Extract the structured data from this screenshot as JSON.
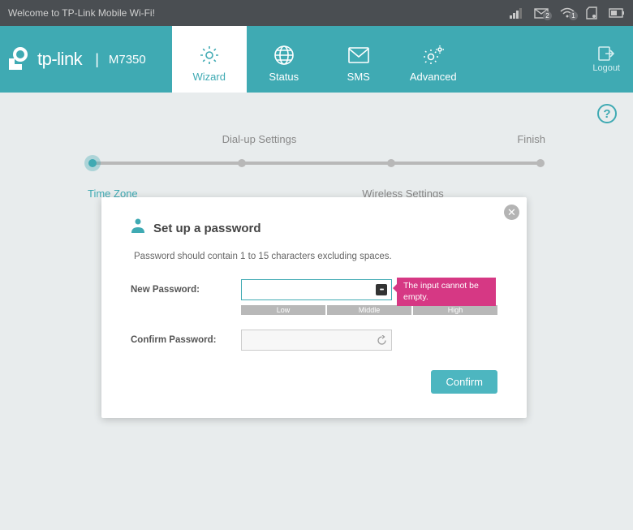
{
  "titlebar": {
    "welcome": "Welcome to TP-Link Mobile Wi-Fi!",
    "msg_badge": "2",
    "wifi_badge": "1"
  },
  "brand": {
    "name": "tp-link",
    "model": "M7350"
  },
  "nav": {
    "wizard": "Wizard",
    "status": "Status",
    "sms": "SMS",
    "advanced": "Advanced",
    "logout": "Logout"
  },
  "steps": {
    "dial": "Dial-up Settings",
    "finish": "Finish",
    "timezone": "Time Zone",
    "wireless": "Wireless Settings"
  },
  "modal": {
    "title": "Set up a password",
    "desc": "Password should contain 1 to 15 characters excluding spaces.",
    "new_pw_label": "New Password:",
    "confirm_pw_label": "Confirm Password:",
    "strength": {
      "low": "Low",
      "mid": "Middle",
      "high": "High"
    },
    "error": "The input cannot be empty.",
    "confirm_btn": "Confirm"
  }
}
